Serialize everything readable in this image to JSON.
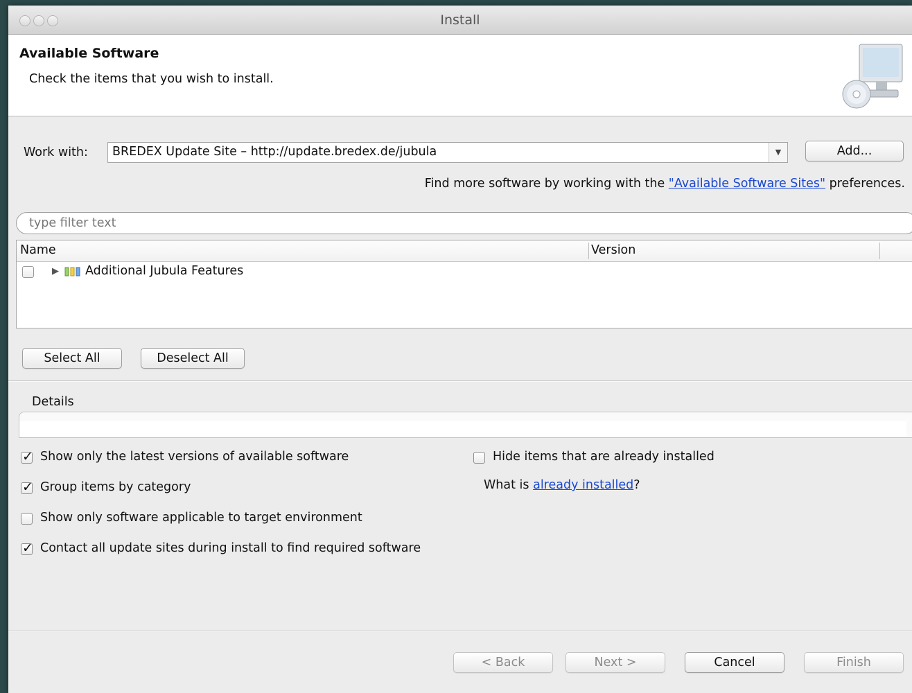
{
  "window": {
    "title": "Install"
  },
  "header": {
    "title": "Available Software",
    "message": "Check the items that you wish to install."
  },
  "work_with": {
    "label": "Work with:",
    "value": "BREDEX Update Site – http://update.bredex.de/jubula",
    "add_label": "Add...",
    "hint_prefix": "Find more software by working with the ",
    "hint_link": "\"Available Software Sites\"",
    "hint_suffix": " preferences."
  },
  "filter": {
    "placeholder": "type filter text"
  },
  "tree": {
    "columns": [
      "Name",
      "Version"
    ],
    "rows": [
      {
        "label": "Additional Jubula Features",
        "checked": false
      }
    ]
  },
  "selection_buttons": {
    "select_all": "Select All",
    "deselect_all": "Deselect All"
  },
  "details": {
    "label": "Details"
  },
  "options": {
    "show_latest": {
      "label": "Show only the latest versions of available software",
      "checked": true
    },
    "group_by_category": {
      "label": "Group items by category",
      "checked": true
    },
    "show_applicable": {
      "label": "Show only software applicable to target environment",
      "checked": false
    },
    "contact_all_sites": {
      "label": "Contact all update sites during install to find required software",
      "checked": true
    },
    "hide_installed": {
      "label": "Hide items that are already installed",
      "checked": false
    },
    "what_is_prefix": "What is ",
    "what_is_link": "already installed",
    "what_is_suffix": "?"
  },
  "footer": {
    "back": "< Back",
    "next": "Next >",
    "cancel": "Cancel",
    "finish": "Finish"
  }
}
